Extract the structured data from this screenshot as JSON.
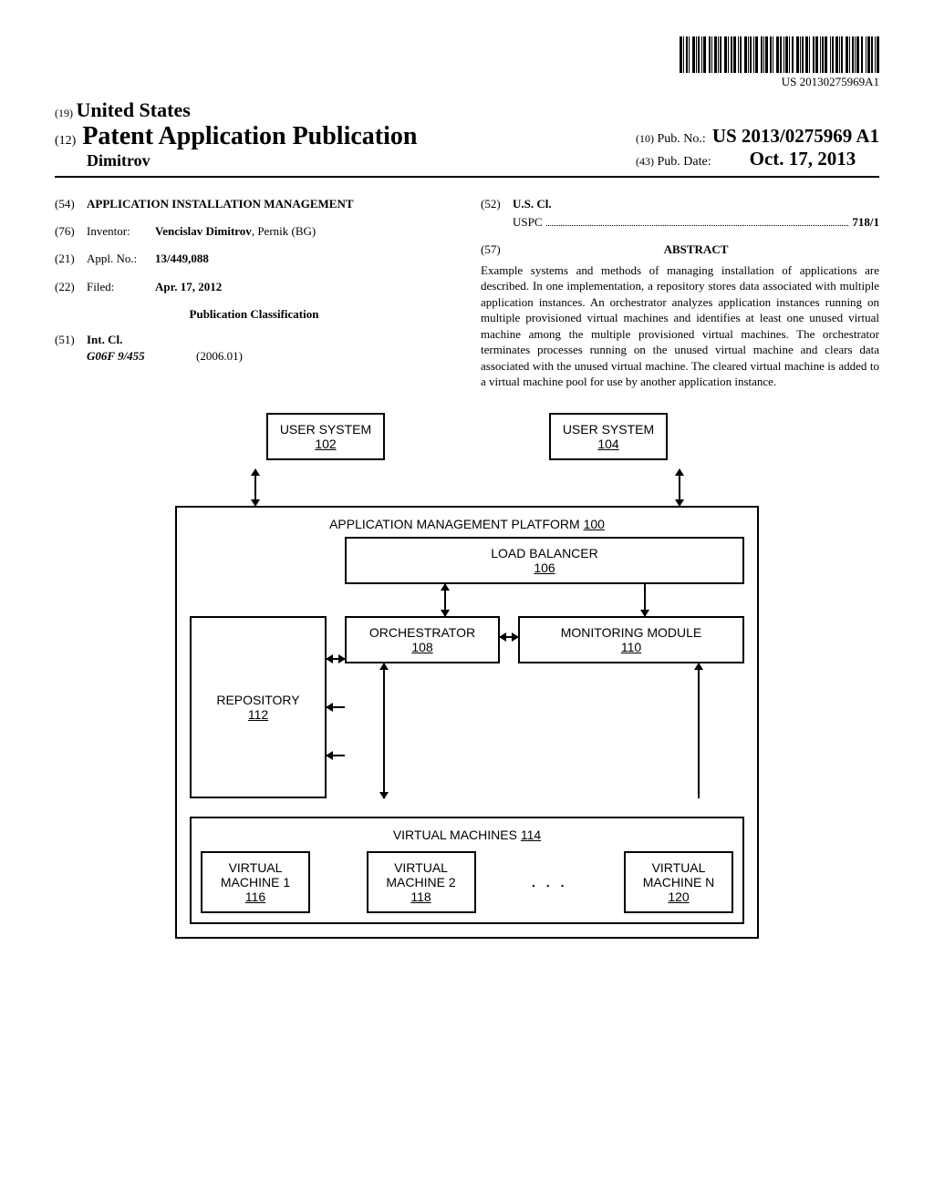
{
  "barcode_text": "US 20130275969A1",
  "header": {
    "line1_prefix": "(19)",
    "line1": "United States",
    "line2_prefix": "(12)",
    "line2": "Patent Application Publication",
    "line3": "Dimitrov",
    "pubno_prefix": "(10)",
    "pubno_label": "Pub. No.:",
    "pubno": "US 2013/0275969 A1",
    "pubdate_prefix": "(43)",
    "pubdate_label": "Pub. Date:",
    "pubdate": "Oct. 17, 2013"
  },
  "left": {
    "title_num": "(54)",
    "title": "APPLICATION INSTALLATION MANAGEMENT",
    "inventor_num": "(76)",
    "inventor_label": "Inventor:",
    "inventor": "Vencislav Dimitrov",
    "inventor_loc": ", Pernik (BG)",
    "applno_num": "(21)",
    "applno_label": "Appl. No.:",
    "applno": "13/449,088",
    "filed_num": "(22)",
    "filed_label": "Filed:",
    "filed": "Apr. 17, 2012",
    "pubclass_heading": "Publication Classification",
    "intcl_num": "(51)",
    "intcl_label": "Int. Cl.",
    "intcl_code": "G06F 9/455",
    "intcl_year": "(2006.01)"
  },
  "right": {
    "uscl_num": "(52)",
    "uscl_label": "U.S. Cl.",
    "uspc_label": "USPC",
    "uspc_val": "718/1",
    "abs_num": "(57)",
    "abs_title": "ABSTRACT",
    "abs_text": "Example systems and methods of managing installation of applications are described. In one implementation, a repository stores data associated with multiple application instances. An orchestrator analyzes application instances running on multiple provisioned virtual machines and identifies at least one unused virtual machine among the multiple provisioned virtual machines. The orchestrator terminates processes running on the unused virtual machine and clears data associated with the unused virtual machine. The cleared virtual machine is added to a virtual machine pool for use by another application instance."
  },
  "diagram": {
    "user1": "USER SYSTEM",
    "user1_ref": "102",
    "user2": "USER SYSTEM",
    "user2_ref": "104",
    "platform": "APPLICATION MANAGEMENT PLATFORM",
    "platform_ref": "100",
    "lb": "LOAD BALANCER",
    "lb_ref": "106",
    "orch": "ORCHESTRATOR",
    "orch_ref": "108",
    "mon": "MONITORING MODULE",
    "mon_ref": "110",
    "repo": "REPOSITORY",
    "repo_ref": "112",
    "vms": "VIRTUAL MACHINES",
    "vms_ref": "114",
    "vm1": "VIRTUAL MACHINE 1",
    "vm1_ref": "116",
    "vm2": "VIRTUAL MACHINE 2",
    "vm2_ref": "118",
    "vmn": "VIRTUAL MACHINE N",
    "vmn_ref": "120",
    "ellipsis": ". . ."
  }
}
